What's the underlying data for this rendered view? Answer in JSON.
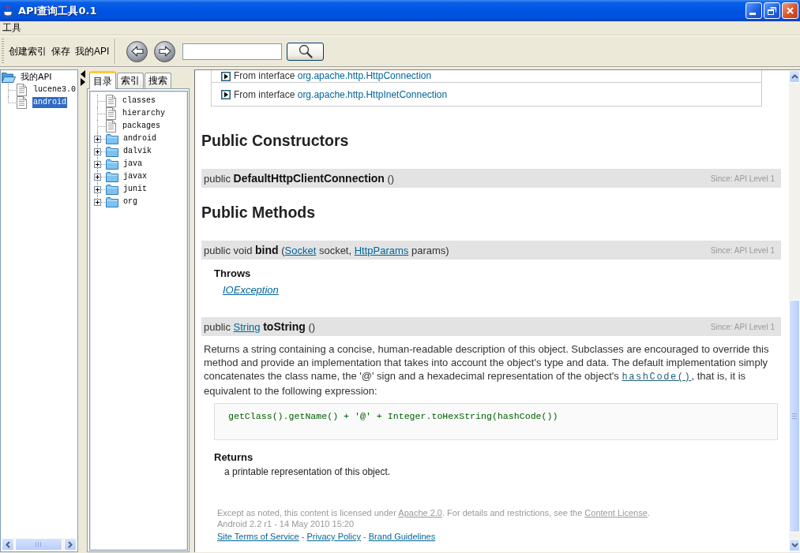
{
  "window": {
    "title": "API查询工具0.1"
  },
  "menu_bar": {
    "items": [
      {
        "label": "工具"
      }
    ]
  },
  "toolbar": {
    "buttons": [
      {
        "label": "创建索引"
      },
      {
        "label": "保存"
      },
      {
        "label": "我的API"
      }
    ]
  },
  "api_tree": {
    "items": [
      {
        "label": "我的API",
        "kind": "folder",
        "expanded": true,
        "selected": false,
        "children": [
          {
            "label": "lucene3.0",
            "kind": "file",
            "selected": false
          },
          {
            "label": "android",
            "kind": "file",
            "selected": true
          }
        ]
      }
    ]
  },
  "navigator": {
    "tabs": [
      {
        "label": "目录",
        "selected": true
      },
      {
        "label": "索引",
        "selected": false
      },
      {
        "label": "搜索",
        "selected": false
      }
    ],
    "tree": {
      "items": [
        {
          "label": "classes",
          "kind": "file",
          "selected": false
        },
        {
          "label": "hierarchy",
          "kind": "file",
          "selected": false
        },
        {
          "label": "packages",
          "kind": "file",
          "selected": false
        },
        {
          "label": "android",
          "kind": "folder",
          "expanded": false,
          "selected": false
        },
        {
          "label": "dalvik",
          "kind": "folder",
          "expanded": false,
          "selected": false
        },
        {
          "label": "java",
          "kind": "folder",
          "expanded": false,
          "selected": false
        },
        {
          "label": "javax",
          "kind": "folder",
          "expanded": false,
          "selected": false
        },
        {
          "label": "junit",
          "kind": "folder",
          "expanded": false,
          "selected": false
        },
        {
          "label": "org",
          "kind": "folder",
          "expanded": false,
          "selected": false
        }
      ]
    }
  },
  "document": {
    "inherited": [
      {
        "prefix": "From interface",
        "link": "org.apache.http.HttpConnection"
      },
      {
        "prefix": "From interface",
        "link": "org.apache.http.HttpInetConnection"
      }
    ],
    "sections": [
      {
        "heading": "Public Constructors",
        "members": [
          {
            "signature": [
              {
                "kind": "text",
                "text": "public **DefaultHttpClientConnection** ()"
              }
            ],
            "since": "Since: API Level 1"
          }
        ]
      },
      {
        "heading": "Public Methods",
        "members": [
          {
            "signature": [
              {
                "kind": "text",
                "text": "public void **bind** ("
              },
              {
                "kind": "link",
                "text": "Socket"
              },
              {
                "kind": "text",
                "text": " socket, "
              },
              {
                "kind": "link",
                "text": "HttpParams"
              },
              {
                "kind": "text",
                "text": " params)"
              }
            ],
            "since": "Since: API Level 1",
            "blocks": [
              {
                "kind": "throws",
                "heading": "Throws",
                "links": [
                  "IOException"
                ]
              }
            ]
          },
          {
            "signature": [
              {
                "kind": "text",
                "text": "public "
              },
              {
                "kind": "link",
                "text": "String"
              },
              {
                "kind": "text",
                "text": " **toString** ()"
              }
            ],
            "since": "Since: API Level 1",
            "blocks": [
              {
                "kind": "paragraph",
                "segments": [
                  {
                    "kind": "text",
                    "text": "Returns a string containing a concise, human-readable description of this object. Subclasses are encouraged to override this method and provide an implementation that takes into account the object's type and data. The default implementation simply concatenates the class name, the '@' sign and a hexadecimal representation of the object's "
                  },
                  {
                    "kind": "code_link",
                    "text": "hashCode()"
                  },
                  {
                    "kind": "text",
                    "text": ", that is, it is equivalent to the following expression:"
                  }
                ]
              },
              {
                "kind": "code",
                "text": "getClass().getName() + '@' + Integer.toHexString(hashCode())"
              },
              {
                "kind": "returns",
                "heading": "Returns",
                "text": "a printable representation of this object."
              }
            ]
          }
        ]
      }
    ],
    "footer": {
      "license": [
        {
          "kind": "text",
          "text": "Except as noted, this content is licensed under "
        },
        {
          "kind": "link",
          "text": "Apache 2.0"
        },
        {
          "kind": "text",
          "text": ". For details and restrictions, see the "
        },
        {
          "kind": "link",
          "text": "Content License"
        },
        {
          "kind": "text",
          "text": "."
        }
      ],
      "build": "Android 2.2 r1 - 14 May 2010 15:20",
      "links": [
        {
          "kind": "link",
          "text": "Site Terms of Service"
        },
        {
          "kind": "text",
          "text": " - "
        },
        {
          "kind": "link",
          "text": "Privacy Policy"
        },
        {
          "kind": "text",
          "text": " - "
        },
        {
          "kind": "link",
          "text": "Brand Guidelines"
        }
      ]
    }
  }
}
